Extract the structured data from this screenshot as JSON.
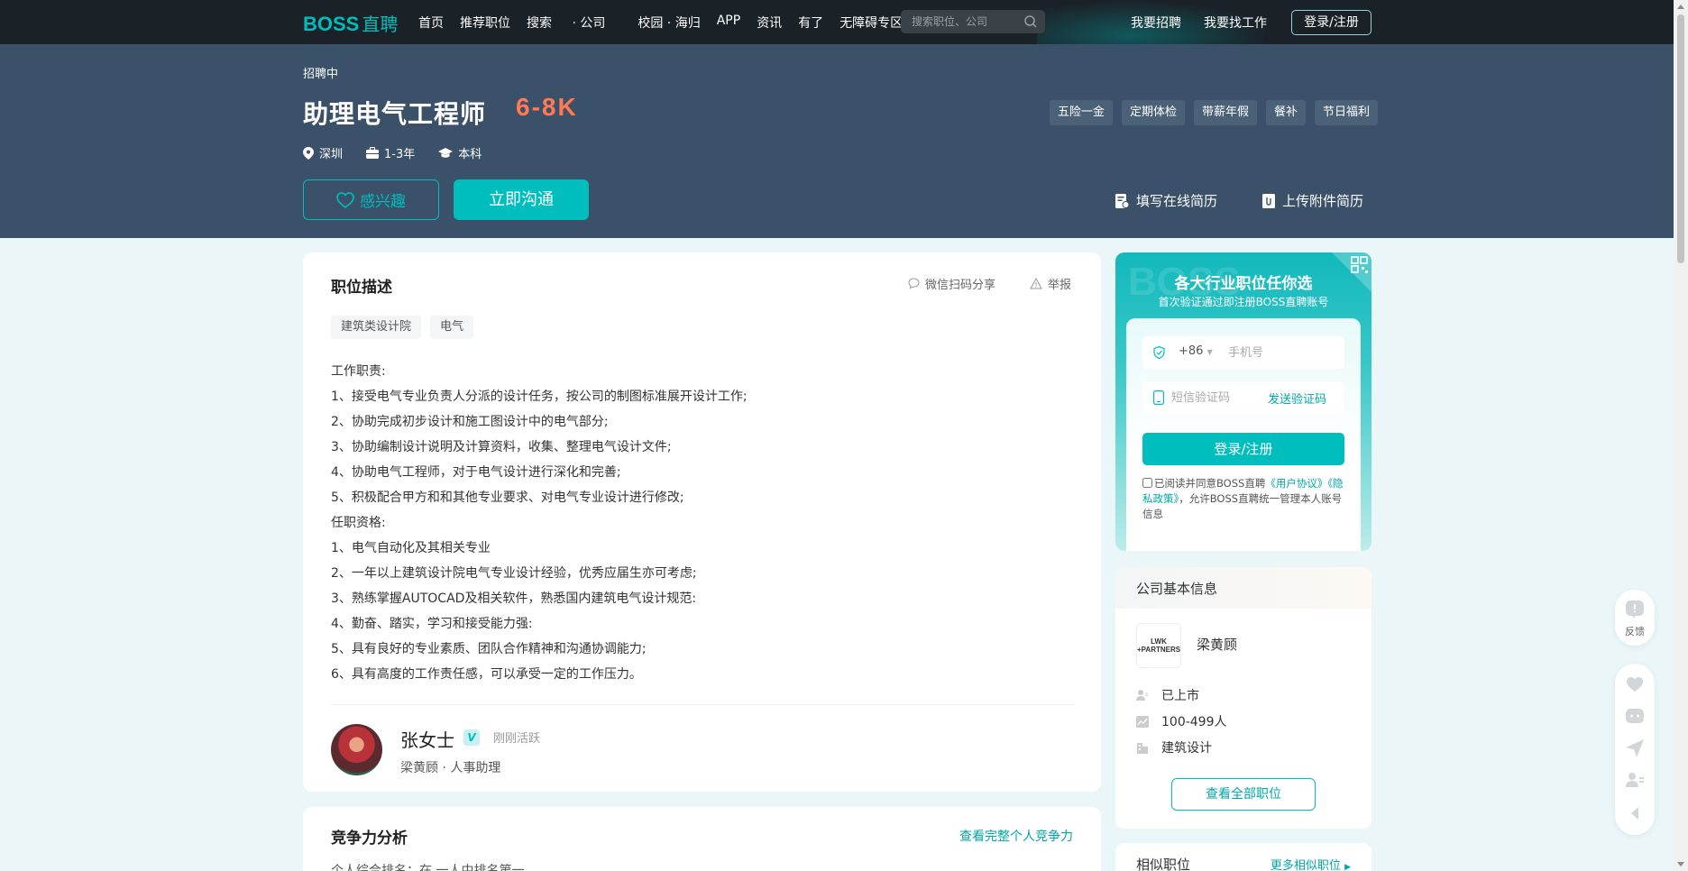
{
  "nav": {
    "logo_latin": "BOSS",
    "logo_cn": "直聘",
    "items": [
      {
        "label": "首页"
      },
      {
        "label": "推荐职位"
      },
      {
        "label": "搜索",
        "suffix": " · 公司"
      },
      {
        "label": "校园 · 海归"
      },
      {
        "label": "APP"
      },
      {
        "label": "资讯"
      },
      {
        "label": "有了"
      },
      {
        "label": "无障碍专区"
      }
    ],
    "search_placeholder": "搜索职位、公司",
    "recruit_label": "我要招聘",
    "findjob_label": "我要找工作",
    "login_label": "登录/注册"
  },
  "job": {
    "status": "招聘中",
    "title": "助理电气工程师",
    "salary": "6-8K",
    "city": "深圳",
    "experience": "1-3年",
    "degree": "本科",
    "benefits": [
      "五险一金",
      "定期体检",
      "带薪年假",
      "餐补",
      "节日福利"
    ],
    "interest_label": "感兴趣",
    "chat_label": "立即沟通",
    "online_resume_label": "填写在线简历",
    "upload_resume_label": "上传附件简历"
  },
  "jd": {
    "heading": "职位描述",
    "share_label": "微信扫码分享",
    "report_label": "举报",
    "tags": [
      "建筑类设计院",
      "电气"
    ],
    "lines": [
      "工作职责:",
      "1、接受电气专业负责人分派的设计任务，按公司的制图标准展开设计工作;",
      "2、协助完成初步设计和施工图设计中的电气部分;",
      "3、协助编制设计说明及计算资料，收集、整理电气设计文件;",
      "4、协助电气工程师，对于电气设计进行深化和完善;",
      "5、积极配合甲方和和其他专业要求、对电气专业设计进行修改;",
      "任职资格:",
      "1、电气自动化及其相关专业",
      "2、一年以上建筑设计院电气专业设计经验，优秀应届生亦可考虑;",
      "3、熟练掌握AUTOCAD及相关软件，熟悉国内建筑电气设计规范:",
      "4、勤奋、踏实，学习和接受能力强:",
      "5、具有良好的专业素质、团队合作精神和沟通协调能力;",
      "6、具有高度的工作责任感，可以承受一定的工作压力。"
    ],
    "recruiter_name": "张女士",
    "recruiter_badge": "V",
    "recruiter_active": "刚刚活跃",
    "recruiter_company": "梁黄顾",
    "recruiter_sep": "·",
    "recruiter_role": "人事助理"
  },
  "competition": {
    "heading": "竞争力分析",
    "more_label": "查看完整个人竞争力",
    "sub": "个人综合排名：在 一人中排名第一"
  },
  "signup": {
    "bg_text": "BOSS",
    "title": "各大行业职位任你选",
    "subtitle": "首次验证通过即注册BOSS直聘账号",
    "country_code": "+86",
    "phone_placeholder": "手机号",
    "code_placeholder": "短信验证码",
    "send_code_label": "发送验证码",
    "submit_label": "登录/注册",
    "agree_prefix": "已阅读并同意BOSS直聘",
    "agree_link1": "《用户协议》",
    "agree_link2": "《隐私政策》",
    "agree_suffix": "，允许BOSS直聘统一管理本人账号信息"
  },
  "company": {
    "heading": "公司基本信息",
    "logo_line1": "LWK",
    "logo_line2": "+PARTNERS",
    "name": "梁黄顾",
    "stage": "已上市",
    "size": "100-499人",
    "industry": "建筑设计",
    "all_jobs_label": "查看全部职位"
  },
  "similar": {
    "heading": "相似职位",
    "more_label": "更多相似职位"
  },
  "tools": {
    "feedback_label": "反馈"
  },
  "colors": {
    "brand": "#00bebd",
    "salary": "#ff7a52",
    "hero_bg": "#3a5169",
    "nav_bg": "#1a2127"
  }
}
